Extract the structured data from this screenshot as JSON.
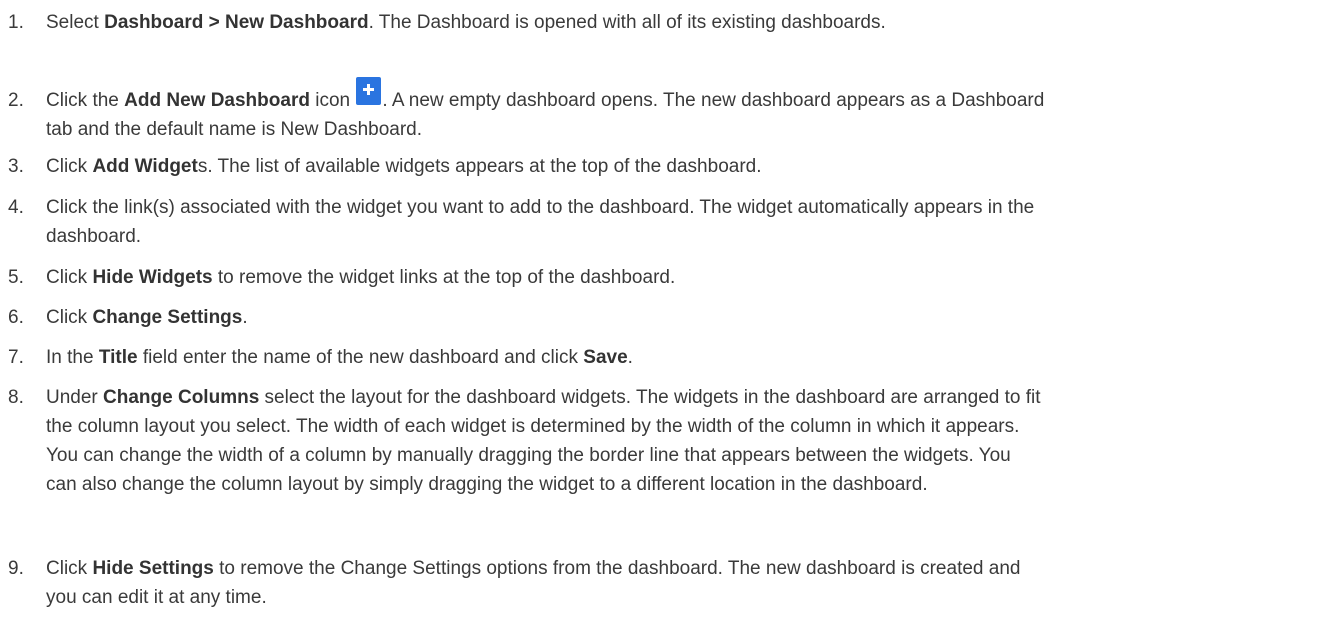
{
  "steps": [
    {
      "num": "1.",
      "parts": [
        "Select ",
        "Dashboard > New Dashboard",
        ". The Dashboard is opened with all of its existing dashboards."
      ]
    },
    {
      "num": "2.",
      "parts": [
        "Click the ",
        "Add New Dashboard",
        " icon ",
        ". A new empty dashboard opens. The new dashboard appears as a Dashboard",
        "tab and the default name is New Dashboard."
      ]
    },
    {
      "num": "3.",
      "parts": [
        "Click ",
        "Add Widget",
        "s. The list of available widgets appears at the top of the dashboard."
      ]
    },
    {
      "num": "4.",
      "parts": [
        "Click the link(s) associated with the widget you want to add to the dashboard. The widget automatically appears in the",
        "dashboard."
      ]
    },
    {
      "num": "5.",
      "parts": [
        "Click ",
        "Hide Widgets",
        " to remove the widget links at the top of the dashboard."
      ]
    },
    {
      "num": "6.",
      "parts": [
        "Click ",
        "Change Settings",
        "."
      ]
    },
    {
      "num": "7.",
      "parts": [
        "In the ",
        "Title",
        " field enter the name of the new dashboard and click ",
        "Save",
        "."
      ]
    },
    {
      "num": "8.",
      "parts": [
        "Under ",
        "Change Columns",
        " select the layout for the dashboard widgets. The widgets in the dashboard are arranged to fit",
        "the column layout you select. The width of each widget is determined by the width of the column in which it appears.",
        "You can change the width of a column by manually dragging the border line that appears between the widgets. You",
        "can also change the column layout by simply dragging the widget to a different location in the dashboard."
      ]
    },
    {
      "num": "9.",
      "parts": [
        "Click ",
        "Hide Settings",
        " to remove the Change Settings options from the dashboard. The new dashboard is created and",
        "you can edit it at any time."
      ]
    }
  ],
  "icons": {
    "add_dashboard": "plus-icon",
    "accent_color": "#2a74e0"
  }
}
